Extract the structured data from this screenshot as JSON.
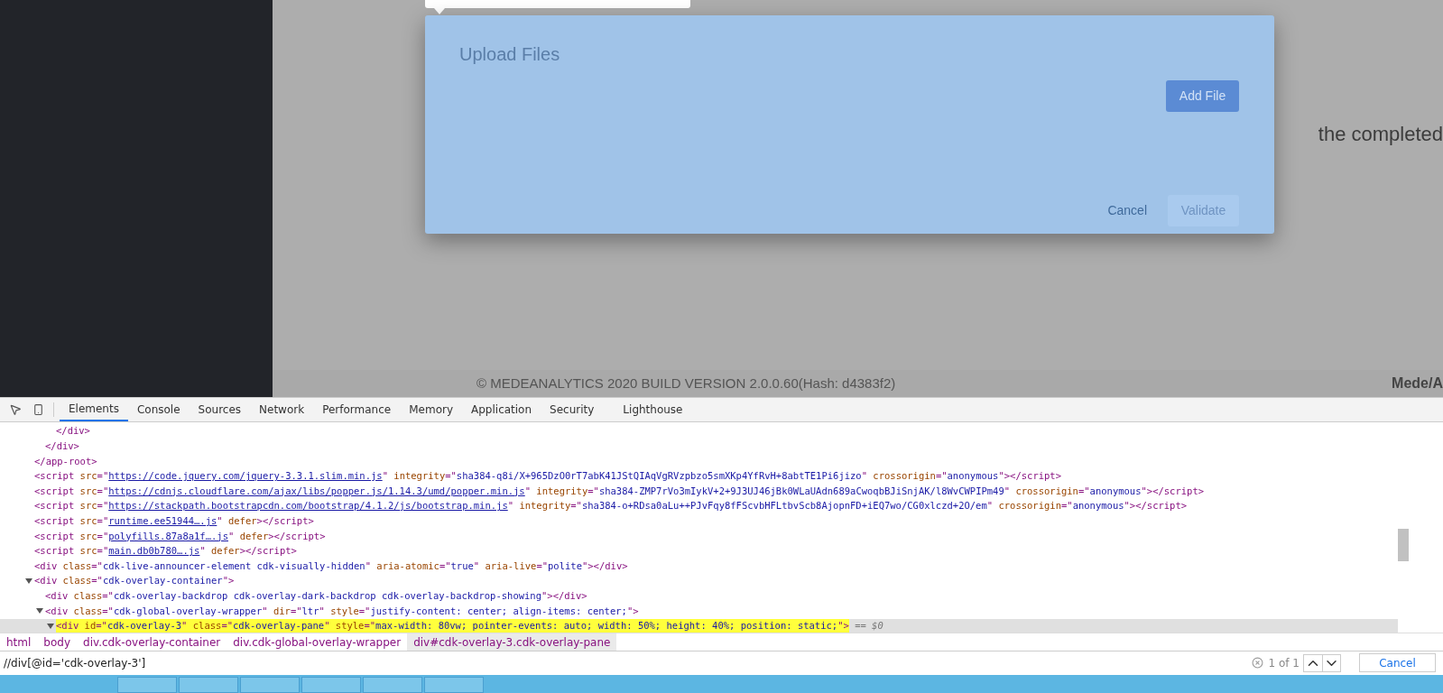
{
  "app": {
    "background_text": "the completed",
    "footer": "© MEDEANALYTICS 2020 BUILD VERSION 2.0.0.60(Hash: d4383f2)",
    "logo": "Mede/A"
  },
  "dialog": {
    "title": "Upload Files",
    "add_button": "Add File",
    "cancel_button": "Cancel",
    "validate_button": {
      "label": "Validate",
      "disabled": true
    }
  },
  "devtools": {
    "tabs": [
      {
        "label": "Elements",
        "selected": true
      },
      {
        "label": "Console",
        "selected": false
      },
      {
        "label": "Sources",
        "selected": false
      },
      {
        "label": "Network",
        "selected": false
      },
      {
        "label": "Performance",
        "selected": false
      },
      {
        "label": "Memory",
        "selected": false
      },
      {
        "label": "Application",
        "selected": false
      },
      {
        "label": "Security",
        "selected": false
      },
      {
        "label": "Lighthouse",
        "selected": false
      }
    ],
    "dom": [
      {
        "kind": "close",
        "selected": false,
        "tokens": [
          {
            "kind": "tag",
            "text": "</app-root>"
          }
        ],
        "children": [
          {
            "kind": "close",
            "selected": false,
            "tokens": [
              {
                "kind": "tag",
                "text": "</div>"
              }
            ],
            "children": [
              {
                "selected": false,
                "tokens": [
                  {
                    "kind": "tag",
                    "text": "</div>"
                  }
                ]
              }
            ]
          }
        ]
      },
      {
        "kind": "open",
        "selected": false,
        "tokens": [
          {
            "kind": "tag",
            "text": "<script"
          },
          {
            "kind": "attr",
            "text": " src"
          },
          {
            "kind": "tag",
            "text": "=\""
          },
          {
            "kind": "link",
            "text": "https://code.jquery.com/jquery-3.3.1.slim.min.js"
          },
          {
            "kind": "tag",
            "text": "\""
          },
          {
            "kind": "attr",
            "text": " integrity"
          },
          {
            "kind": "tag",
            "text": "=\""
          },
          {
            "kind": "value",
            "text": "sha384-q8i/X+965DzO0rT7abK41JStQIAqVgRVzpbzo5smXKp4YfRvH+8abtTE1Pi6jizo"
          },
          {
            "kind": "tag",
            "text": "\""
          },
          {
            "kind": "attr",
            "text": " crossorigin"
          },
          {
            "kind": "tag",
            "text": "=\""
          },
          {
            "kind": "value",
            "text": "anonymous"
          },
          {
            "kind": "tag",
            "text": "\"></script>"
          }
        ]
      },
      {
        "kind": "open",
        "selected": false,
        "tokens": [
          {
            "kind": "tag",
            "text": "<script"
          },
          {
            "kind": "attr",
            "text": " src"
          },
          {
            "kind": "tag",
            "text": "=\""
          },
          {
            "kind": "link",
            "text": "https://cdnjs.cloudflare.com/ajax/libs/popper.js/1.14.3/umd/popper.min.js"
          },
          {
            "kind": "tag",
            "text": "\""
          },
          {
            "kind": "attr",
            "text": " integrity"
          },
          {
            "kind": "tag",
            "text": "=\""
          },
          {
            "kind": "value",
            "text": "sha384-ZMP7rVo3mIykV+2+9J3UJ46jBk0WLaUAdn689aCwoqbBJiSnjAK/l8WvCWPIPm49"
          },
          {
            "kind": "tag",
            "text": "\""
          },
          {
            "kind": "attr",
            "text": " crossorigin"
          },
          {
            "kind": "tag",
            "text": "=\""
          },
          {
            "kind": "value",
            "text": "anonymous"
          },
          {
            "kind": "tag",
            "text": "\"></script>"
          }
        ]
      },
      {
        "kind": "open",
        "selected": false,
        "tokens": [
          {
            "kind": "tag",
            "text": "<script"
          },
          {
            "kind": "attr",
            "text": " src"
          },
          {
            "kind": "tag",
            "text": "=\""
          },
          {
            "kind": "link",
            "text": "https://stackpath.bootstrapcdn.com/bootstrap/4.1.2/js/bootstrap.min.js"
          },
          {
            "kind": "tag",
            "text": "\""
          },
          {
            "kind": "attr",
            "text": " integrity"
          },
          {
            "kind": "tag",
            "text": "=\""
          },
          {
            "kind": "value",
            "text": "sha384-o+RDsa0aLu++PJvFqy8fFScvbHFLtbvScb8AjopnFD+iEQ7wo/CG0xlczd+2O/em"
          },
          {
            "kind": "tag",
            "text": "\""
          },
          {
            "kind": "attr",
            "text": " crossorigin"
          },
          {
            "kind": "tag",
            "text": "=\""
          },
          {
            "kind": "value",
            "text": "anonymous"
          },
          {
            "kind": "tag",
            "text": "\"></script>"
          }
        ]
      },
      {
        "kind": "open",
        "selected": false,
        "tokens": [
          {
            "kind": "tag",
            "text": "<script"
          },
          {
            "kind": "attr",
            "text": " src"
          },
          {
            "kind": "tag",
            "text": "=\""
          },
          {
            "kind": "link",
            "text": "runtime.ee51944….js"
          },
          {
            "kind": "tag",
            "text": "\""
          },
          {
            "kind": "attr",
            "text": " defer"
          },
          {
            "kind": "tag",
            "text": "></script>"
          }
        ]
      },
      {
        "kind": "open",
        "selected": false,
        "tokens": [
          {
            "kind": "tag",
            "text": "<script"
          },
          {
            "kind": "attr",
            "text": " src"
          },
          {
            "kind": "tag",
            "text": "=\""
          },
          {
            "kind": "link",
            "text": "polyfills.87a8a1f….js"
          },
          {
            "kind": "tag",
            "text": "\""
          },
          {
            "kind": "attr",
            "text": " defer"
          },
          {
            "kind": "tag",
            "text": "></script>"
          }
        ]
      },
      {
        "kind": "open",
        "selected": false,
        "tokens": [
          {
            "kind": "tag",
            "text": "<script"
          },
          {
            "kind": "attr",
            "text": " src"
          },
          {
            "kind": "tag",
            "text": "=\""
          },
          {
            "kind": "link",
            "text": "main.db0b780….js"
          },
          {
            "kind": "tag",
            "text": "\""
          },
          {
            "kind": "attr",
            "text": " defer"
          },
          {
            "kind": "tag",
            "text": "></script>"
          }
        ]
      },
      {
        "kind": "open",
        "selected": false,
        "tokens": [
          {
            "kind": "tag",
            "text": "<div"
          },
          {
            "kind": "attr",
            "text": " class"
          },
          {
            "kind": "tag",
            "text": "=\""
          },
          {
            "kind": "value",
            "text": "cdk-live-announcer-element cdk-visually-hidden"
          },
          {
            "kind": "tag",
            "text": "\""
          },
          {
            "kind": "attr",
            "text": " aria-atomic"
          },
          {
            "kind": "tag",
            "text": "=\""
          },
          {
            "kind": "value",
            "text": "true"
          },
          {
            "kind": "tag",
            "text": "\""
          },
          {
            "kind": "attr",
            "text": " aria-live"
          },
          {
            "kind": "tag",
            "text": "=\""
          },
          {
            "kind": "value",
            "text": "polite"
          },
          {
            "kind": "tag",
            "text": "\"></div>"
          }
        ]
      },
      {
        "kind": "open",
        "selected": false,
        "expanded": true,
        "tokens": [
          {
            "kind": "tag",
            "text": "<div"
          },
          {
            "kind": "attr",
            "text": " class"
          },
          {
            "kind": "tag",
            "text": "=\""
          },
          {
            "kind": "value",
            "text": "cdk-overlay-container"
          },
          {
            "kind": "tag",
            "text": "\">"
          }
        ],
        "children": [
          {
            "kind": "open",
            "selected": false,
            "tokens": [
              {
                "kind": "tag",
                "text": "<div"
              },
              {
                "kind": "attr",
                "text": " class"
              },
              {
                "kind": "tag",
                "text": "=\""
              },
              {
                "kind": "value",
                "text": "cdk-overlay-backdrop cdk-overlay-dark-backdrop cdk-overlay-backdrop-showing"
              },
              {
                "kind": "tag",
                "text": "\"></div>"
              }
            ]
          },
          {
            "kind": "open",
            "selected": false,
            "expanded": true,
            "tokens": [
              {
                "kind": "tag",
                "text": "<div"
              },
              {
                "kind": "attr",
                "text": " class"
              },
              {
                "kind": "tag",
                "text": "=\""
              },
              {
                "kind": "value",
                "text": "cdk-global-overlay-wrapper"
              },
              {
                "kind": "tag",
                "text": "\""
              },
              {
                "kind": "attr",
                "text": " dir"
              },
              {
                "kind": "tag",
                "text": "=\""
              },
              {
                "kind": "value",
                "text": "ltr"
              },
              {
                "kind": "tag",
                "text": "\""
              },
              {
                "kind": "attr",
                "text": " style"
              },
              {
                "kind": "tag",
                "text": "=\""
              },
              {
                "kind": "value",
                "text": "justify-content: center; align-items: center;"
              },
              {
                "kind": "tag",
                "text": "\">"
              }
            ],
            "children": [
              {
                "selected": true,
                "expanded": true,
                "tokens": [
                  {
                    "kind": "tag",
                    "text": "<div"
                  },
                  {
                    "kind": "attr",
                    "text": " id"
                  },
                  {
                    "kind": "tag",
                    "text": "=\""
                  },
                  {
                    "kind": "value",
                    "text": "cdk-overlay-3"
                  },
                  {
                    "kind": "tag",
                    "text": "\""
                  },
                  {
                    "kind": "attr",
                    "text": " class"
                  },
                  {
                    "kind": "tag",
                    "text": "=\""
                  },
                  {
                    "kind": "value",
                    "text": "cdk-overlay-pane"
                  },
                  {
                    "kind": "tag",
                    "text": "\""
                  },
                  {
                    "kind": "attr",
                    "text": " style"
                  },
                  {
                    "kind": "tag",
                    "text": "=\""
                  },
                  {
                    "kind": "value",
                    "text": "max-width: 80vw; pointer-events: auto; width: 50%; height: 40%; position: static;"
                  },
                  {
                    "kind": "tag",
                    "text": "\">"
                  },
                  {
                    "kind": "note",
                    "text": " == $0"
                  }
                ]
              }
            ]
          }
        ]
      }
    ],
    "breadcrumbs": [
      {
        "label": "html",
        "selected": false
      },
      {
        "label": "body",
        "selected": false
      },
      {
        "label": "div.cdk-overlay-container",
        "selected": false
      },
      {
        "label": "div.cdk-global-overlay-wrapper",
        "selected": false
      },
      {
        "label": "div#cdk-overlay-3.cdk-overlay-pane",
        "selected": true
      }
    ],
    "search": {
      "value": "//div[@id='cdk-overlay-3']",
      "count": "1 of 1",
      "cancel": "Cancel"
    }
  }
}
